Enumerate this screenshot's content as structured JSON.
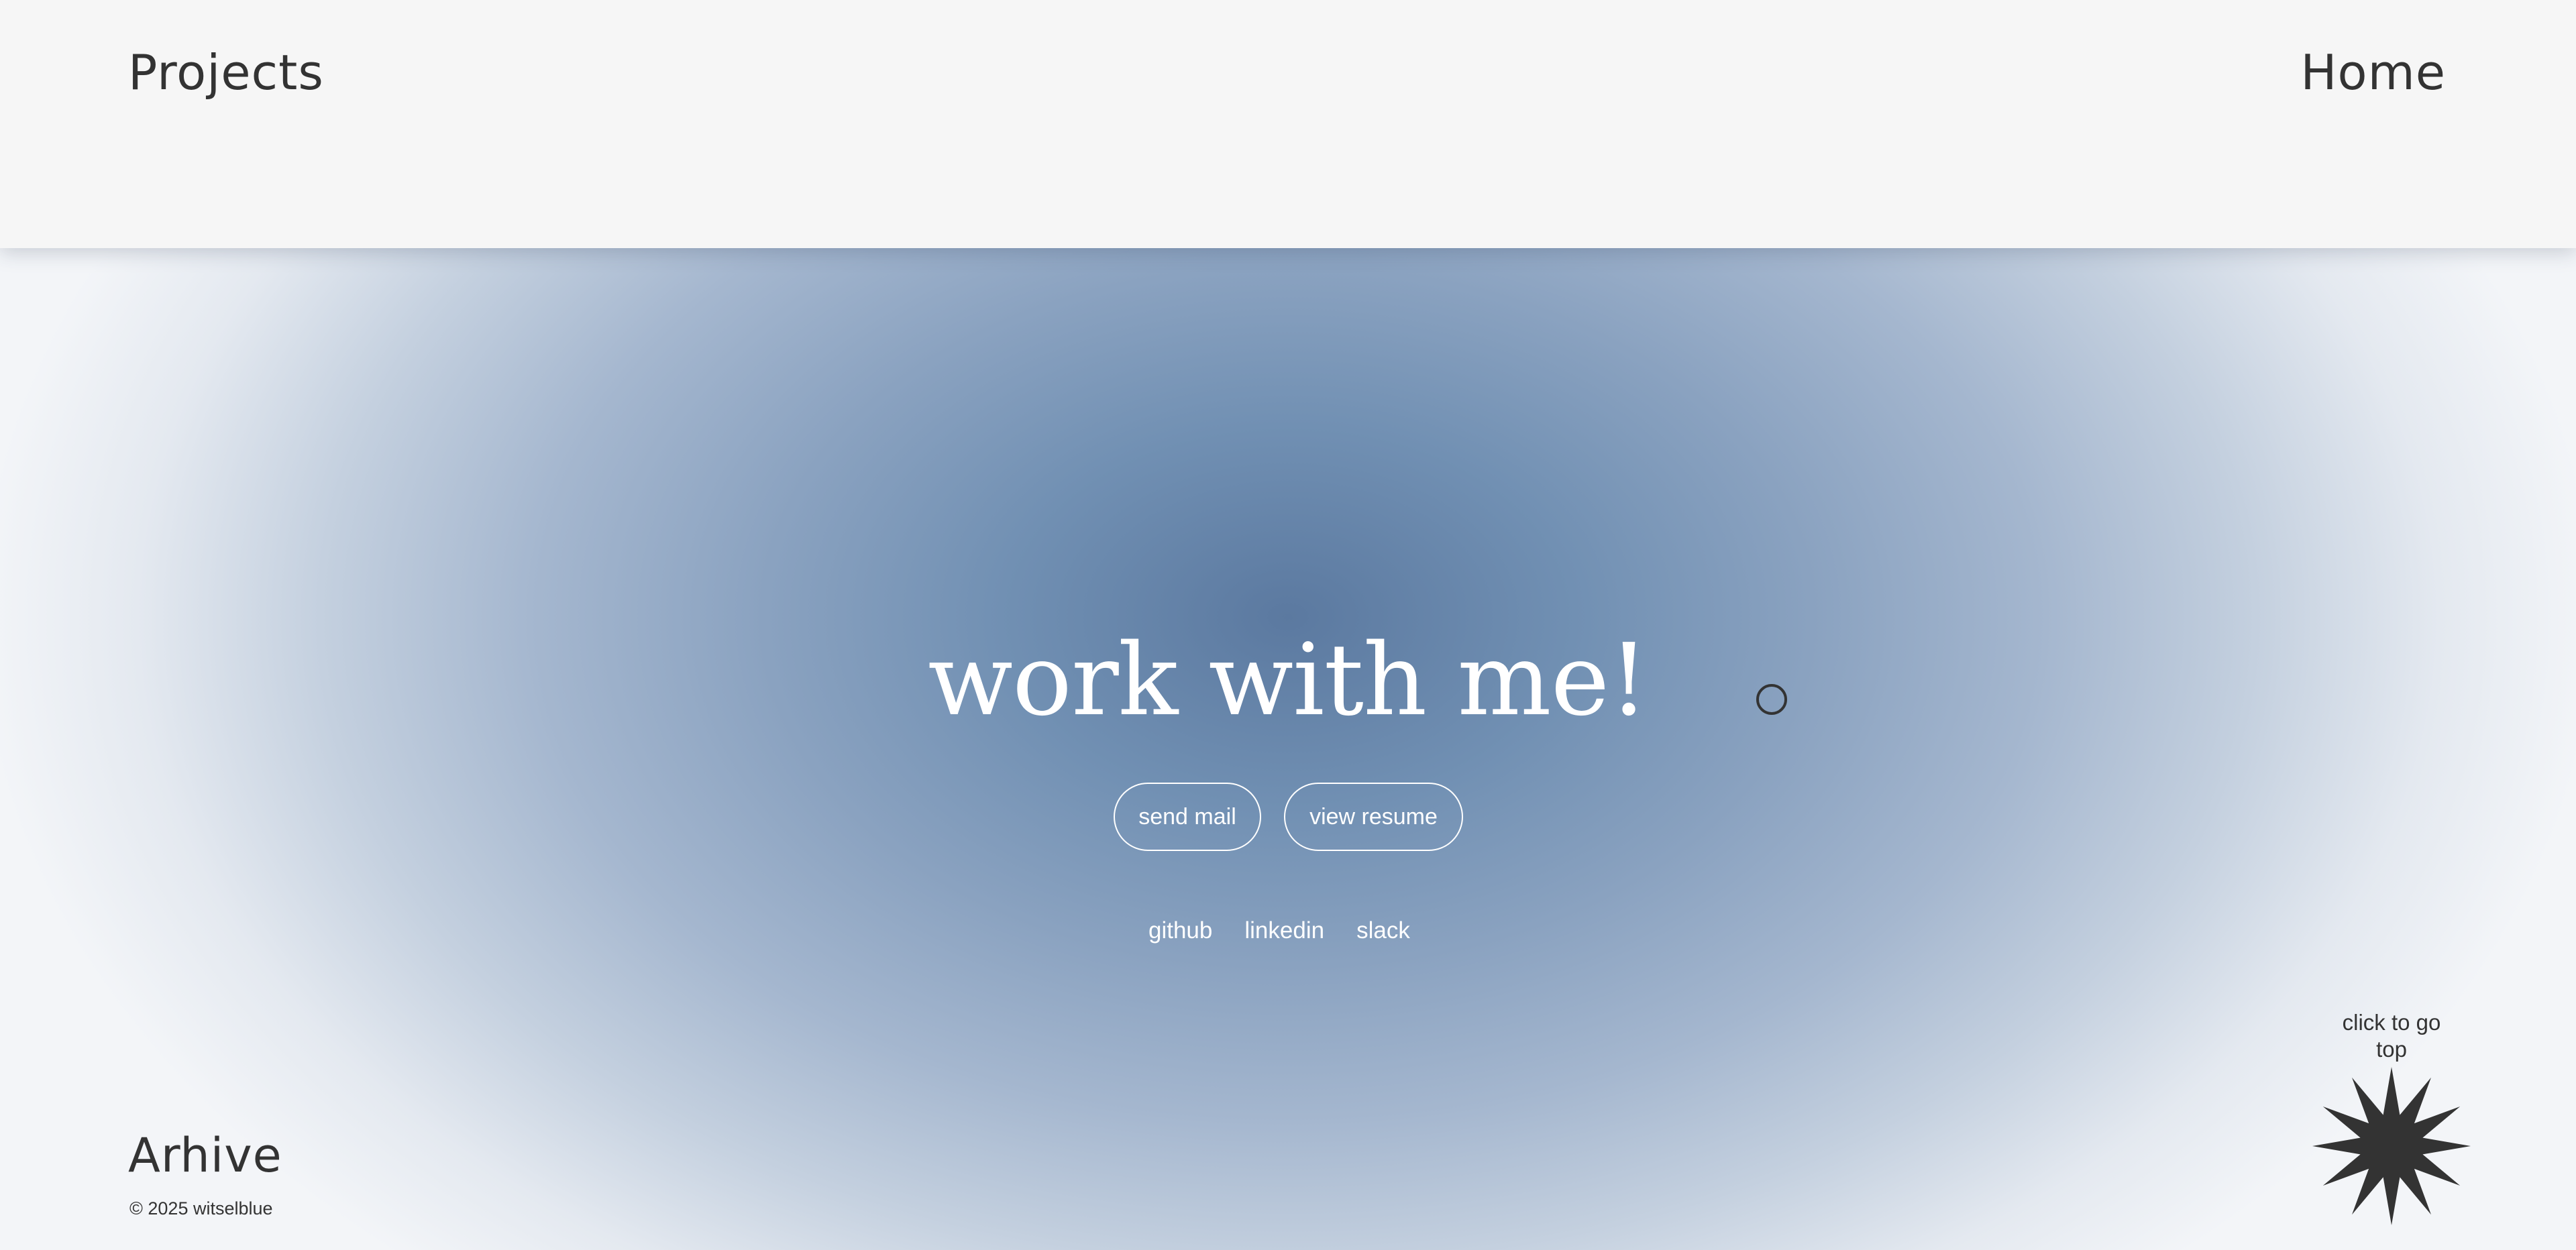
{
  "header": {
    "left_link": "Projects",
    "right_link": "Home"
  },
  "hero": {
    "title": "work with me!",
    "buttons": {
      "send_mail": "send mail",
      "view_resume": "view resume"
    },
    "social_links": {
      "github": "github",
      "linkedin": "linkedin",
      "slack": "slack"
    }
  },
  "footer": {
    "title": "Arhive",
    "copyright": "© 2025 witselblue",
    "go_top_label": "click to go top"
  },
  "colors": {
    "text_dark": "#333333",
    "hero_center": "#5b79a0",
    "hero_edge": "#f3f5f8",
    "header_bg": "#f6f6f6"
  },
  "icons": {
    "cursor": "cursor-ring-icon",
    "go_top": "starburst-icon"
  }
}
